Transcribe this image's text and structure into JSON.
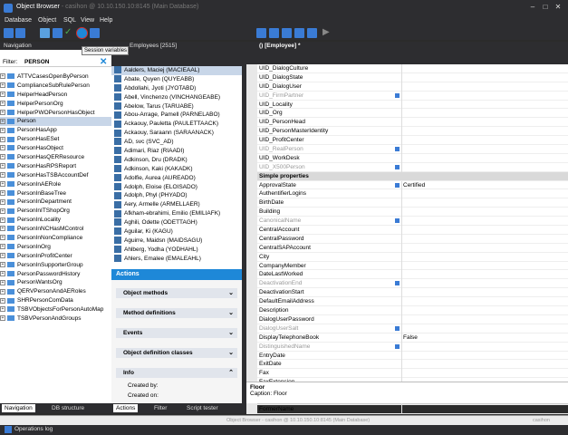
{
  "window": {
    "title": "Object Browser",
    "subtitle": "- casihon @ 10.10.150.10:8145 (Main Database)"
  },
  "menu": [
    "Database",
    "Object",
    "SQL",
    "View",
    "Help"
  ],
  "tooltip": "Session variables",
  "navigation": {
    "title": "Navigation",
    "filter_label": "Filter:",
    "filter_value": "PERSON",
    "items": [
      "ATTVCasesOpenByPerson",
      "ComplianceSubRulePerson",
      "HelperHeadPerson",
      "HelperPersonOrg",
      "HelperPWOPersonHasObject",
      "Person",
      "PersonHasApp",
      "PersonHasESet",
      "PersonHasObject",
      "PersonHasQERResource",
      "PersonHasRPSReport",
      "PersonHasTSBAccountDef",
      "PersonInAERole",
      "PersonInBaseTree",
      "PersonInDepartment",
      "PersonInITShopOrg",
      "PersonInLocality",
      "PersonInNCHasMControl",
      "PersonInNonCompliance",
      "PersonInOrg",
      "PersonInProfitCenter",
      "PersonInSupporterGroup",
      "PersonPasswordHistory",
      "PersonWantsOrg",
      "QERVPersonAndAERoles",
      "SHRPersonComData",
      "TSBVObjectsForPersonAutoMap",
      "TSBVPersonAndGroups"
    ],
    "selected": "Person",
    "tabs": [
      "Navigation",
      "DB structure"
    ]
  },
  "employees": {
    "title": "Employees [2515]",
    "items": [
      "Aalders, Maciej (MACIEAAL)",
      "Abate, Quyen (QUYEABB)",
      "Abdollahi, Jyoti (JYOTABD)",
      "Abell, Vinchenzo (VINCHANGEABE)",
      "Abelow, Tarus (TARUABE)",
      "Abou-Arrage, Pamell (PARNELABO)",
      "Ackaouy, Pauletta (PAULETTAACK)",
      "Ackaouy, Saraann (SARAANACK)",
      "AD, svc (SVC_AD)",
      "Adimari, Riaz (RIAADI)",
      "Adkinson, Dru (DRADK)",
      "Adkinson, Kaki (KAKADK)",
      "Adolfie, Aurea (AUREADO)",
      "Adolph, Eloise (ELOISADO)",
      "Adolph, Phyl (PHYADO)",
      "Aery, Armelle (ARMELLAER)",
      "Afkham-ebrahimi, Emilio (EMILIAFK)",
      "Aghili, Odette (ODETTAGH)",
      "Aguilar, Ki (KAGU)",
      "Aguirre, Maidsn (MAIDSAGU)",
      "Ahlberg, Yodha (YODHAHL)",
      "Ahlers, Emalee (EMALEAHL)"
    ],
    "selected": "Aalders, Maciej (MACIEAAL)"
  },
  "actions": {
    "title": "Actions",
    "sections": [
      "Object methods",
      "Method definitions",
      "Events",
      "Object definition classes"
    ],
    "info_label": "Info",
    "info_lines": [
      "Created by:",
      "Created on:"
    ],
    "tabs": [
      "Actions",
      "Filter",
      "Script tester"
    ]
  },
  "properties": {
    "tab_title": "() [Employee] *",
    "rows": [
      {
        "name": "UID_DialogCulture",
        "value": "",
        "gray": false,
        "mark": false
      },
      {
        "name": "UID_DialogState",
        "value": "",
        "gray": false,
        "mark": false
      },
      {
        "name": "UID_DialogUser",
        "value": "",
        "gray": false,
        "mark": false
      },
      {
        "name": "UID_FirmPartner",
        "value": "",
        "gray": true,
        "mark": true
      },
      {
        "name": "UID_Locality",
        "value": "",
        "gray": false,
        "mark": false
      },
      {
        "name": "UID_Org",
        "value": "",
        "gray": false,
        "mark": false
      },
      {
        "name": "UID_PersonHead",
        "value": "",
        "gray": false,
        "mark": false
      },
      {
        "name": "UID_PersonMasterIdentity",
        "value": "",
        "gray": false,
        "mark": false
      },
      {
        "name": "UID_ProfitCenter",
        "value": "",
        "gray": false,
        "mark": false
      },
      {
        "name": "UID_RealPerson",
        "value": "",
        "gray": true,
        "mark": true
      },
      {
        "name": "UID_WorkDesk",
        "value": "",
        "gray": false,
        "mark": false
      },
      {
        "name": "UID_X500Person",
        "value": "",
        "gray": true,
        "mark": true
      },
      {
        "name": "Simple properties",
        "value": "",
        "group": true
      },
      {
        "name": "ApprovalState",
        "value": "Certified",
        "gray": false,
        "mark": true
      },
      {
        "name": "AuthentifierLogins",
        "value": "",
        "gray": false,
        "mark": false
      },
      {
        "name": "BirthDate",
        "value": "",
        "gray": false,
        "mark": false
      },
      {
        "name": "Building",
        "value": "",
        "gray": false,
        "mark": false
      },
      {
        "name": "CanonicalName",
        "value": "",
        "gray": true,
        "mark": true
      },
      {
        "name": "CentralAccount",
        "value": "",
        "gray": false,
        "mark": false
      },
      {
        "name": "CentralPassword",
        "value": "",
        "gray": false,
        "mark": false
      },
      {
        "name": "CentralSAPAccount",
        "value": "",
        "gray": false,
        "mark": false
      },
      {
        "name": "City",
        "value": "",
        "gray": false,
        "mark": false
      },
      {
        "name": "CompanyMember",
        "value": "",
        "gray": false,
        "mark": false
      },
      {
        "name": "DateLastWorked",
        "value": "",
        "gray": false,
        "mark": false
      },
      {
        "name": "DeactivationEnd",
        "value": "",
        "gray": true,
        "mark": true
      },
      {
        "name": "DeactivationStart",
        "value": "",
        "gray": false,
        "mark": false
      },
      {
        "name": "DefaultEmailAddress",
        "value": "",
        "gray": false,
        "mark": false
      },
      {
        "name": "Description",
        "value": "",
        "gray": false,
        "mark": false
      },
      {
        "name": "DialogUserPassword",
        "value": "",
        "gray": false,
        "mark": false
      },
      {
        "name": "DialogUserSalt",
        "value": "",
        "gray": true,
        "mark": true
      },
      {
        "name": "DisplayTelephoneBook",
        "value": "False",
        "gray": false,
        "mark": false
      },
      {
        "name": "DistinguishedName",
        "value": "",
        "gray": true,
        "mark": true
      },
      {
        "name": "EntryDate",
        "value": "",
        "gray": false,
        "mark": false
      },
      {
        "name": "ExitDate",
        "value": "",
        "gray": false,
        "mark": false
      },
      {
        "name": "Fax",
        "value": "",
        "gray": false,
        "mark": false
      },
      {
        "name": "FaxExtension",
        "value": "",
        "gray": false,
        "mark": false
      },
      {
        "name": "FirstName",
        "value": "",
        "gray": false,
        "mark": true
      },
      {
        "name": "Floor",
        "value": "",
        "gray": false,
        "mark": false,
        "selected": true
      },
      {
        "name": "FormerName",
        "value": "",
        "gray": false,
        "mark": false
      }
    ],
    "description_title": "Floor",
    "description_text": "Caption: Floor"
  },
  "statusbar": {
    "text": "Object Browser - casihon @ 10.10.150.10:8145 (Main Database)",
    "user": "casihon"
  },
  "operations_log": "Operations log"
}
